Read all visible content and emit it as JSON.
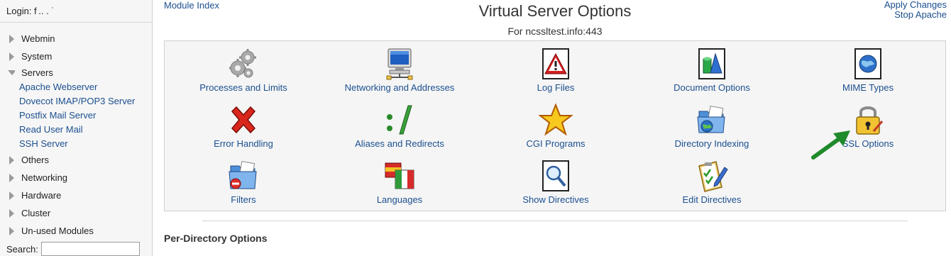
{
  "sidebar": {
    "login_label": "Login: f .. . ˙",
    "categories": [
      {
        "label": "Webmin",
        "state": "collapsed"
      },
      {
        "label": "System",
        "state": "collapsed"
      },
      {
        "label": "Servers",
        "state": "expanded",
        "items": [
          "Apache Webserver",
          "Dovecot IMAP/POP3 Server",
          "Postfix Mail Server",
          "Read User Mail",
          "SSH Server"
        ]
      },
      {
        "label": "Others",
        "state": "collapsed"
      },
      {
        "label": "Networking",
        "state": "collapsed"
      },
      {
        "label": "Hardware",
        "state": "collapsed"
      },
      {
        "label": "Cluster",
        "state": "collapsed"
      },
      {
        "label": "Un-used Modules",
        "state": "collapsed"
      }
    ],
    "search_label": "Search:",
    "search_value": ""
  },
  "header": {
    "module_index": "Module Index",
    "title": "Virtual Server Options",
    "subtitle": "For ncssltest.info:443",
    "apply_changes": "Apply Changes",
    "stop_apache": "Stop Apache"
  },
  "options": {
    "processes": "Processes and Limits",
    "networking": "Networking and Addresses",
    "log_files": "Log Files",
    "document_options": "Document Options",
    "mime_types": "MIME Types",
    "error_handling": "Error Handling",
    "aliases": "Aliases and Redirects",
    "cgi": "CGI Programs",
    "directory_indexing": "Directory Indexing",
    "ssl_options": "SSL Options",
    "filters": "Filters",
    "languages": "Languages",
    "show_directives": "Show Directives",
    "edit_directives": "Edit Directives"
  },
  "section": {
    "per_directory": "Per-Directory Options"
  },
  "colors": {
    "link": "#1b4f8f",
    "panel_bg": "#f5f5f5",
    "sidebar_bg": "#f6f6f6",
    "annotation_arrow": "#1f8a2a"
  }
}
